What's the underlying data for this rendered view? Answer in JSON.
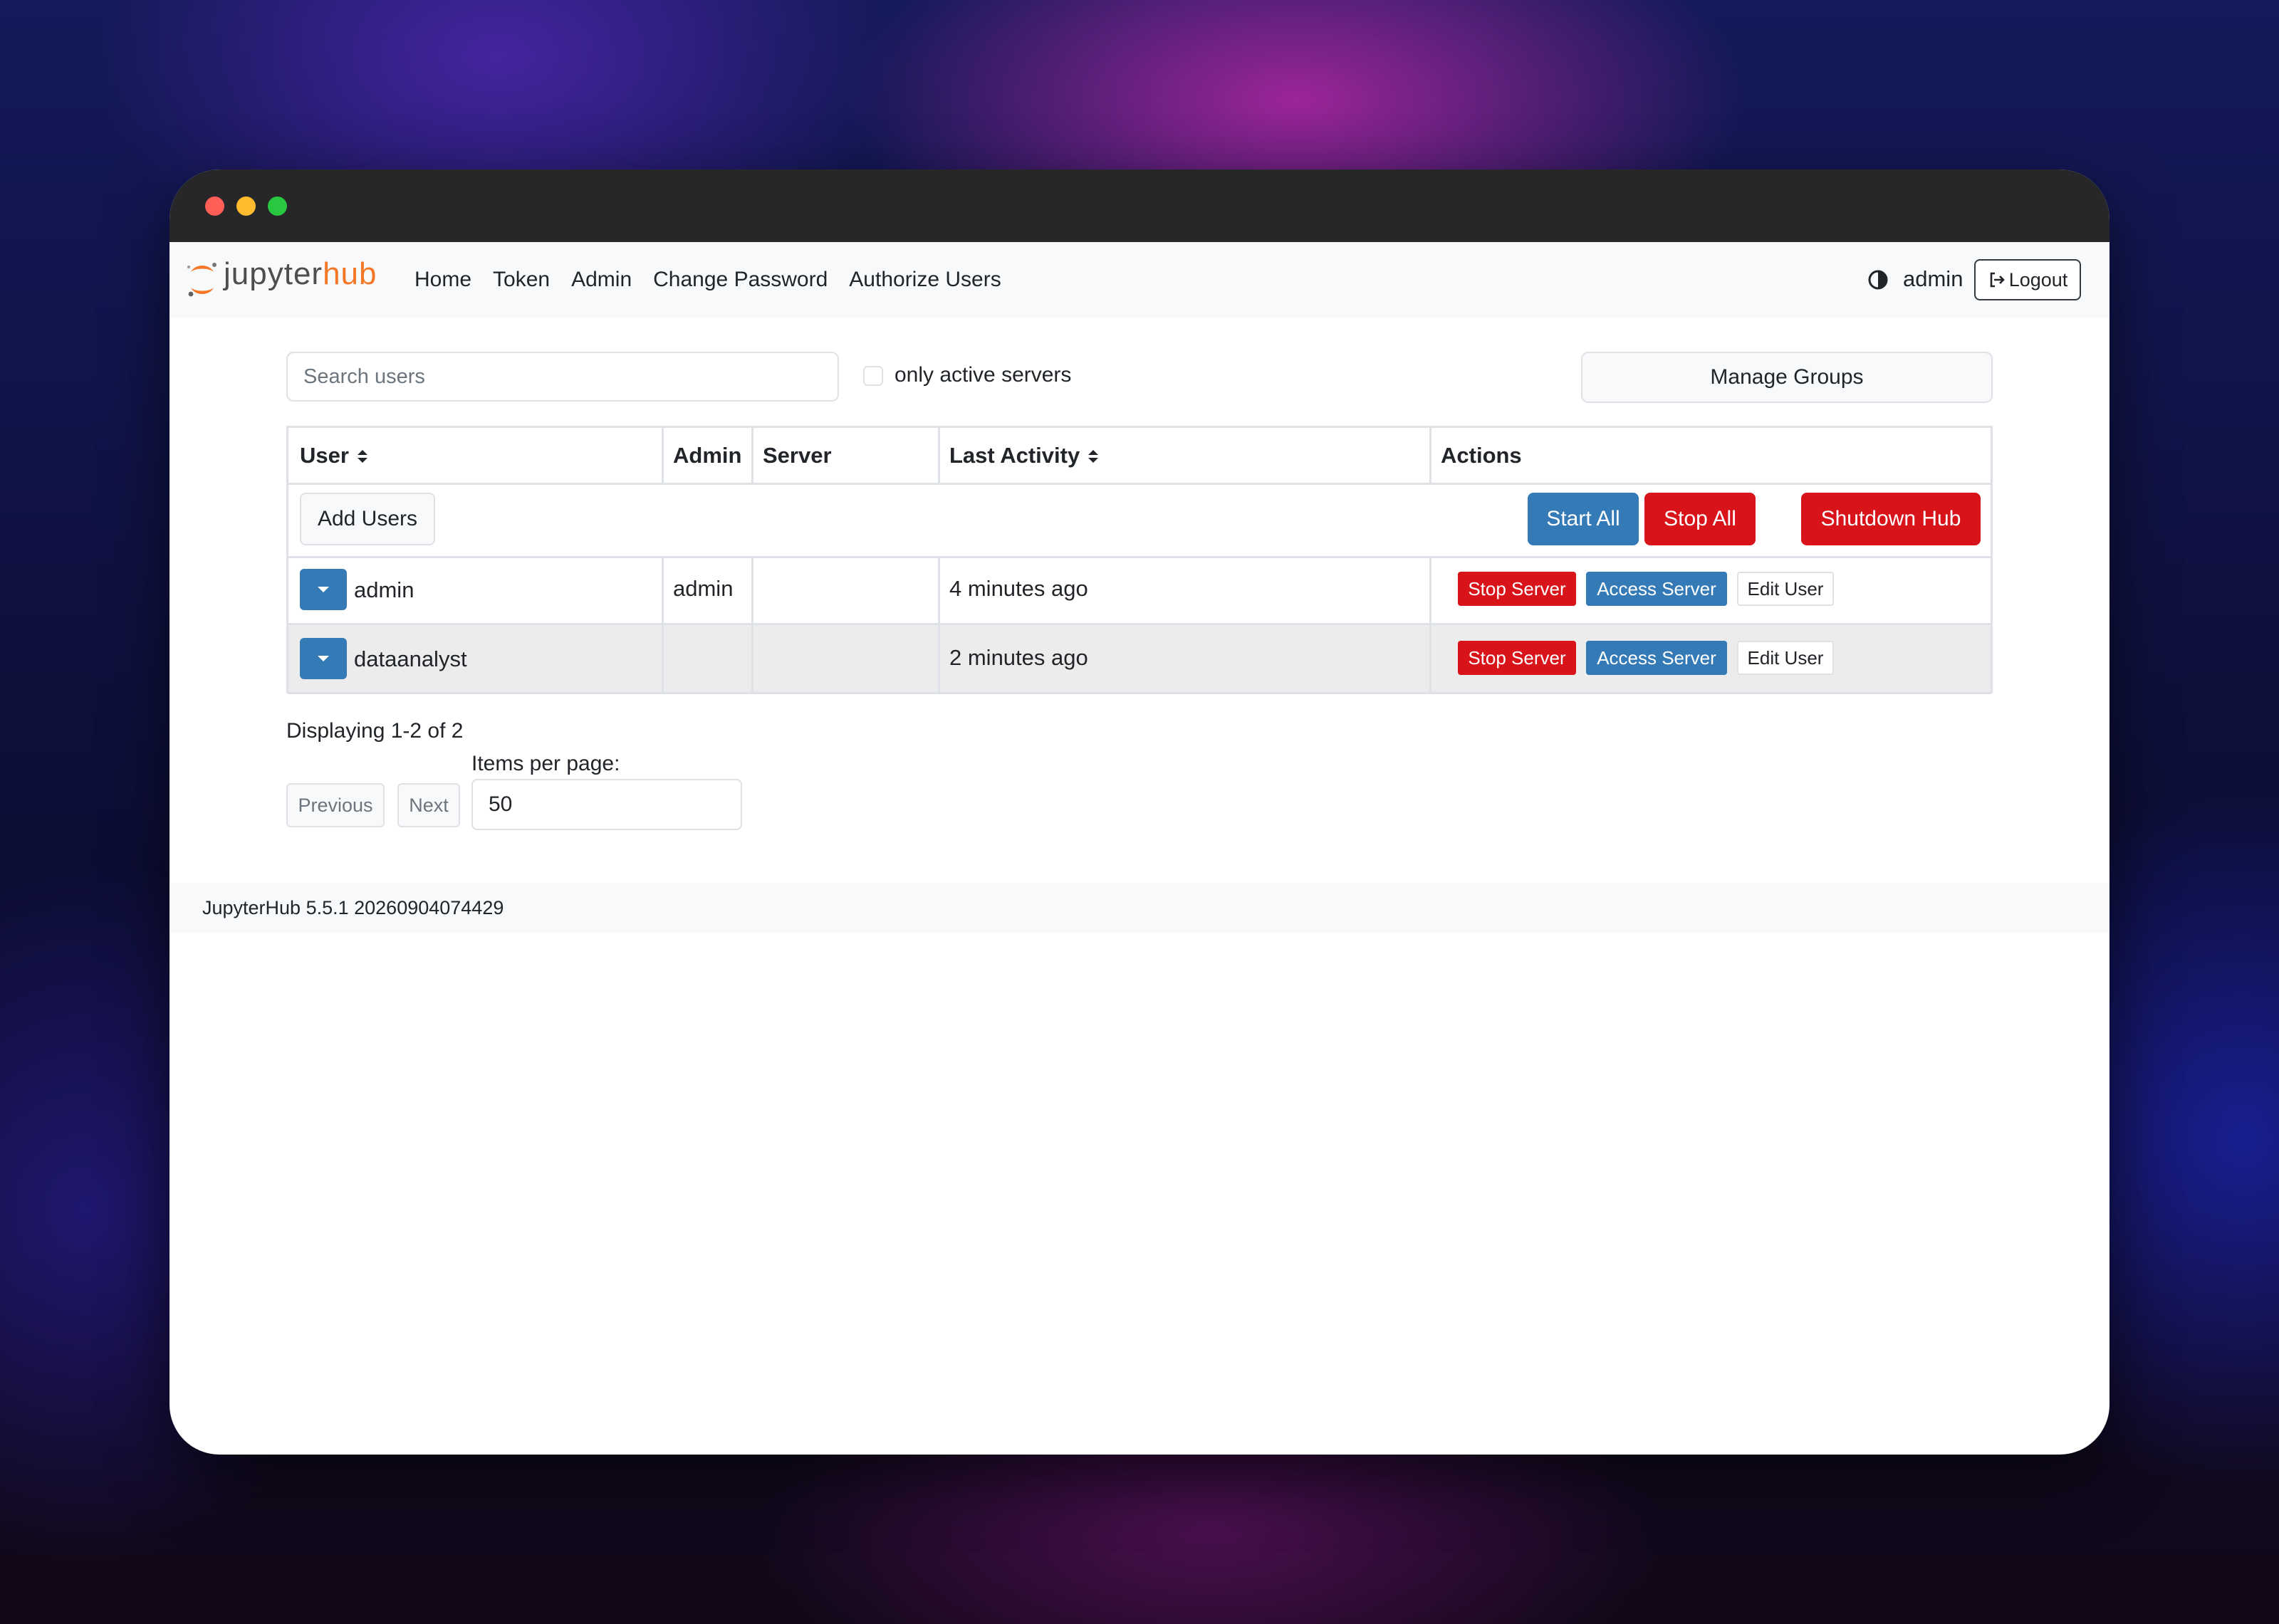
{
  "brand": {
    "name_part1": "jupyter",
    "name_part2": "hub",
    "accent": "#f37726"
  },
  "nav": {
    "links": [
      "Home",
      "Token",
      "Admin",
      "Change Password",
      "Authorize Users"
    ],
    "username": "admin",
    "theme_icon": "contrast-icon",
    "logout_label": "Logout",
    "logout_icon": "logout-icon"
  },
  "controls": {
    "search_placeholder": "Search users",
    "active_filter_label": "only active servers",
    "active_filter_checked": false,
    "manage_groups_label": "Manage Groups"
  },
  "table": {
    "headers": {
      "user": "User",
      "admin": "Admin",
      "server": "Server",
      "last_activity": "Last Activity",
      "actions": "Actions"
    },
    "actions_row": {
      "add_users": "Add Users",
      "start_all": "Start All",
      "stop_all": "Stop All",
      "shutdown_hub": "Shutdown Hub"
    },
    "rows": [
      {
        "user": "admin",
        "admin": "admin",
        "server": "",
        "last_activity": "4 minutes ago",
        "stop_label": "Stop Server",
        "access_label": "Access Server",
        "edit_label": "Edit User"
      },
      {
        "user": "dataanalyst",
        "admin": "",
        "server": "",
        "last_activity": "2 minutes ago",
        "stop_label": "Stop Server",
        "access_label": "Access Server",
        "edit_label": "Edit User"
      }
    ]
  },
  "pagination": {
    "display_text": "Displaying 1-2 of 2",
    "items_per_page_label": "Items per page:",
    "items_per_page_value": "50",
    "previous_label": "Previous",
    "next_label": "Next"
  },
  "footer": {
    "version_text": "JupyterHub 5.5.1 20260904074429"
  },
  "colors": {
    "primary": "#337ab7",
    "danger": "#d9131a",
    "navbar_bg": "#f8f9fa",
    "titlebar": "#27272a"
  }
}
